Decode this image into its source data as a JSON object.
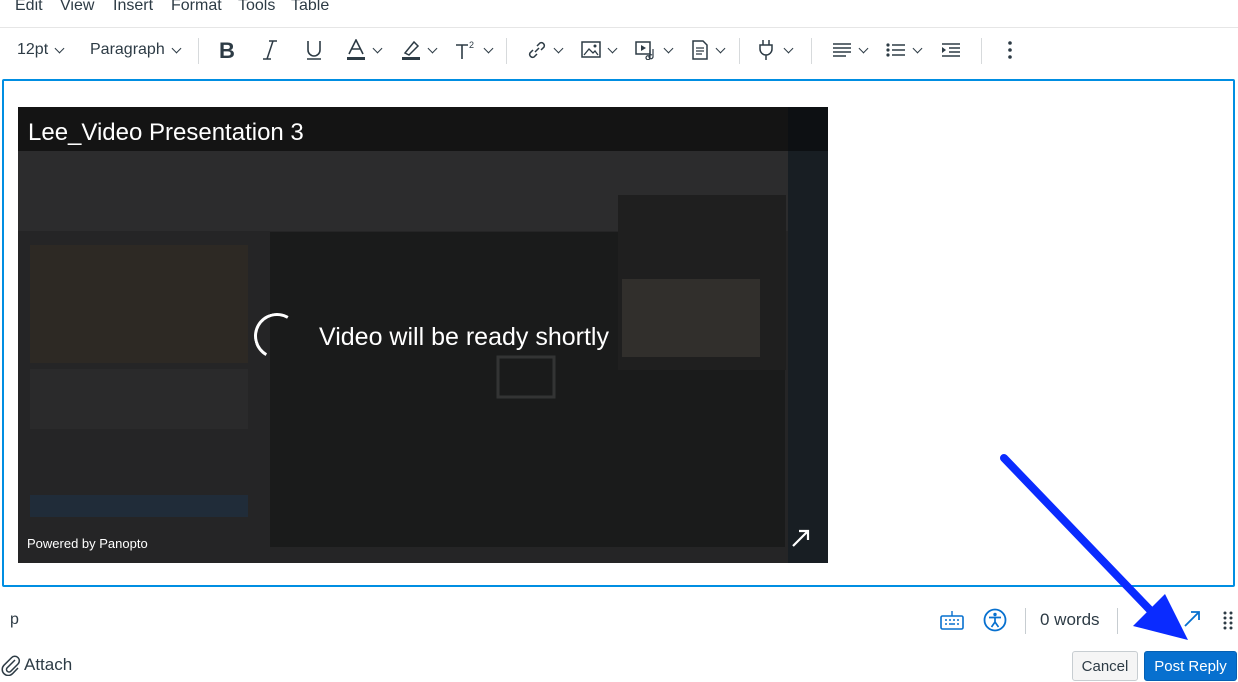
{
  "menu": {
    "edit": "Edit",
    "view": "View",
    "insert": "Insert",
    "format": "Format",
    "tools": "Tools",
    "table": "Table"
  },
  "toolbar": {
    "font_size": "12pt",
    "block_format": "Paragraph"
  },
  "video": {
    "title": "Lee_Video Presentation 3",
    "status_message": "Video will be ready shortly",
    "powered_by": "Powered by Panopto"
  },
  "statusbar": {
    "element_path": "p",
    "word_count": "0 words"
  },
  "footer": {
    "attach_label": "Attach",
    "cancel_label": "Cancel",
    "post_reply_label": "Post Reply"
  },
  "colors": {
    "editor_border": "#008ee2",
    "primary_button": "#0770cf",
    "annotation_arrow": "#0a2bff"
  }
}
